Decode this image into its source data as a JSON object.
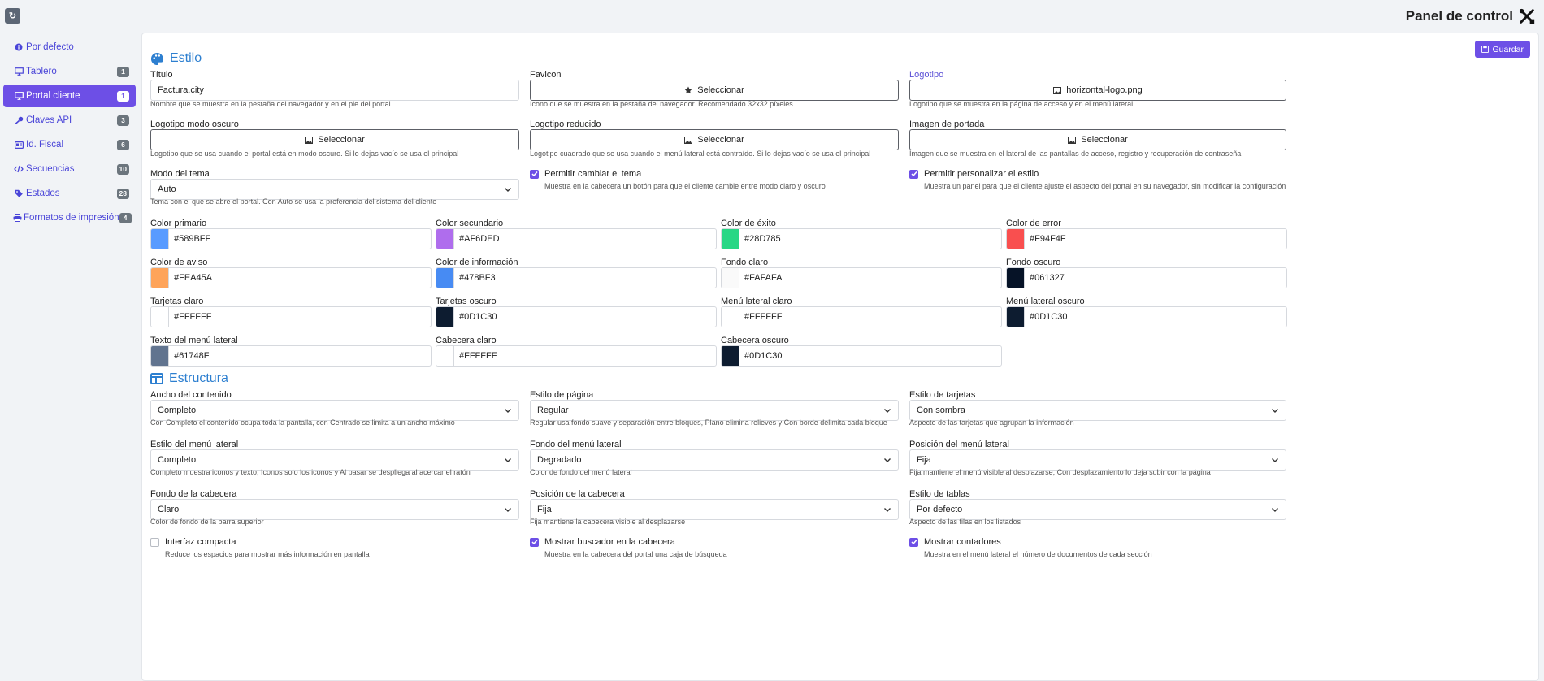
{
  "header": {
    "title": "Panel de control",
    "refresh_icon": "refresh-icon",
    "tools_icon": "tools-icon"
  },
  "sidebar": {
    "items": [
      {
        "label": "Por defecto",
        "icon": "info-icon",
        "badge": null
      },
      {
        "label": "Tablero",
        "icon": "monitor-icon",
        "badge": "1"
      },
      {
        "label": "Portal cliente",
        "icon": "monitor-icon",
        "badge": "1",
        "active": true
      },
      {
        "label": "Claves API",
        "icon": "key-icon",
        "badge": "3"
      },
      {
        "label": "Id. Fiscal",
        "icon": "id-card-icon",
        "badge": "6"
      },
      {
        "label": "Secuencias",
        "icon": "code-icon",
        "badge": "10"
      },
      {
        "label": "Estados",
        "icon": "tags-icon",
        "badge": "28"
      },
      {
        "label": "Formatos de impresión",
        "icon": "printer-icon",
        "badge": "4"
      }
    ]
  },
  "toolbar": {
    "save_label": "Guardar"
  },
  "estilo": {
    "title": "Estilo",
    "titulo": {
      "label": "Título",
      "value": "Factura.city",
      "help": "Nombre que se muestra en la pestaña del navegador y en el pie del portal"
    },
    "favicon": {
      "label": "Favicon",
      "button": "Seleccionar",
      "help": "Icono que se muestra en la pestaña del navegador. Recomendado 32x32 píxeles"
    },
    "logotipo": {
      "label": "Logotipo",
      "button": "horizontal-logo.png",
      "help": "Logotipo que se muestra en la página de acceso y en el menú lateral"
    },
    "logo_oscuro": {
      "label": "Logotipo modo oscuro",
      "button": "Seleccionar",
      "help": "Logotipo que se usa cuando el portal está en modo oscuro. Si lo dejas vacío se usa el principal"
    },
    "logo_reducido": {
      "label": "Logotipo reducido",
      "button": "Seleccionar",
      "help": "Logotipo cuadrado que se usa cuando el menú lateral está contraído. Si lo dejas vacío se usa el principal"
    },
    "portada": {
      "label": "Imagen de portada",
      "button": "Seleccionar",
      "help": "Imagen que se muestra en el lateral de las pantallas de acceso, registro y recuperación de contraseña"
    },
    "modo_tema": {
      "label": "Modo del tema",
      "value": "Auto",
      "help": "Tema con el que se abre el portal. Con Auto se usa la preferencia del sistema del cliente"
    },
    "cambiar_tema": {
      "label": "Permitir cambiar el tema",
      "checked": true,
      "help": "Muestra en la cabecera un botón para que el cliente cambie entre modo claro y oscuro"
    },
    "personalizar": {
      "label": "Permitir personalizar el estilo",
      "checked": true,
      "help": "Muestra un panel para que el cliente ajuste el aspecto del portal en su navegador, sin modificar la configuración"
    },
    "colors": [
      {
        "label": "Color primario",
        "value": "#589BFF"
      },
      {
        "label": "Color secundario",
        "value": "#AF6DED"
      },
      {
        "label": "Color de éxito",
        "value": "#28D785"
      },
      {
        "label": "Color de error",
        "value": "#F94F4F"
      },
      {
        "label": "Color de aviso",
        "value": "#FEA45A"
      },
      {
        "label": "Color de información",
        "value": "#478BF3"
      },
      {
        "label": "Fondo claro",
        "value": "#FAFAFA"
      },
      {
        "label": "Fondo oscuro",
        "value": "#061327"
      },
      {
        "label": "Tarjetas claro",
        "value": "#FFFFFF"
      },
      {
        "label": "Tarjetas oscuro",
        "value": "#0D1C30"
      },
      {
        "label": "Menú lateral claro",
        "value": "#FFFFFF"
      },
      {
        "label": "Menú lateral oscuro",
        "value": "#0D1C30"
      },
      {
        "label": "Texto del menú lateral",
        "value": "#61748F"
      },
      {
        "label": "Cabecera claro",
        "value": "#FFFFFF"
      },
      {
        "label": "Cabecera oscuro",
        "value": "#0D1C30"
      }
    ]
  },
  "estructura": {
    "title": "Estructura",
    "selects": [
      {
        "label": "Ancho del contenido",
        "value": "Completo",
        "help": "Con Completo el contenido ocupa toda la pantalla, con Centrado se limita a un ancho máximo"
      },
      {
        "label": "Estilo de página",
        "value": "Regular",
        "help": "Regular usa fondo suave y separación entre bloques, Plano elimina relieves y Con borde delimita cada bloque"
      },
      {
        "label": "Estilo de tarjetas",
        "value": "Con sombra",
        "help": "Aspecto de las tarjetas que agrupan la información"
      },
      {
        "label": "Estilo del menú lateral",
        "value": "Completo",
        "help": "Completo muestra iconos y texto, Iconos solo los iconos y Al pasar se despliega al acercar el ratón"
      },
      {
        "label": "Fondo del menú lateral",
        "value": "Degradado",
        "help": "Color de fondo del menú lateral"
      },
      {
        "label": "Posición del menú lateral",
        "value": "Fija",
        "help": "Fija mantiene el menú visible al desplazarse, Con desplazamiento lo deja subir con la página"
      },
      {
        "label": "Fondo de la cabecera",
        "value": "Claro",
        "help": "Color de fondo de la barra superior"
      },
      {
        "label": "Posición de la cabecera",
        "value": "Fija",
        "help": "Fija mantiene la cabecera visible al desplazarse"
      },
      {
        "label": "Estilo de tablas",
        "value": "Por defecto",
        "help": "Aspecto de las filas en los listados"
      }
    ],
    "checks": [
      {
        "label": "Interfaz compacta",
        "checked": false,
        "help": "Reduce los espacios para mostrar más información en pantalla"
      },
      {
        "label": "Mostrar buscador en la cabecera",
        "checked": true,
        "help": "Muestra en la cabecera del portal una caja de búsqueda"
      },
      {
        "label": "Mostrar contadores",
        "checked": true,
        "help": "Muestra en el menú lateral el número de documentos de cada sección"
      }
    ]
  }
}
